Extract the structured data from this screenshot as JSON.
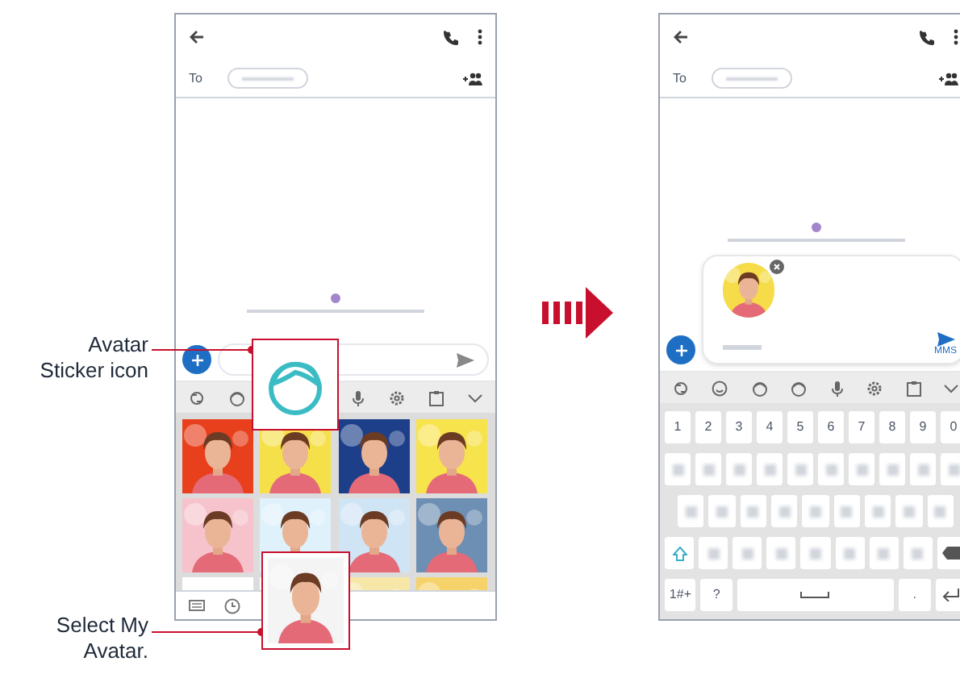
{
  "callouts": [
    {
      "text": "Avatar Sticker icon"
    },
    {
      "text": "Select My Avatar."
    }
  ],
  "left_screen": {
    "to_label": "To"
  },
  "right_screen": {
    "to_label": "To",
    "send_label": "MMS",
    "number_keys": [
      "1",
      "2",
      "3",
      "4",
      "5",
      "6",
      "7",
      "8",
      "9",
      "0"
    ],
    "letter_rows": [
      [
        {
          "kind": "letter"
        },
        {
          "kind": "letter"
        },
        {
          "kind": "letter"
        },
        {
          "kind": "letter"
        },
        {
          "kind": "letter"
        },
        {
          "kind": "letter"
        },
        {
          "kind": "letter"
        },
        {
          "kind": "letter"
        },
        {
          "kind": "letter"
        },
        {
          "kind": "letter"
        }
      ],
      [
        {
          "kind": "letter"
        },
        {
          "kind": "letter"
        },
        {
          "kind": "letter"
        },
        {
          "kind": "letter"
        },
        {
          "kind": "letter"
        },
        {
          "kind": "letter"
        },
        {
          "kind": "letter"
        },
        {
          "kind": "letter"
        },
        {
          "kind": "letter"
        }
      ],
      [
        {
          "kind": "shift"
        },
        {
          "kind": "letter"
        },
        {
          "kind": "letter"
        },
        {
          "kind": "letter"
        },
        {
          "kind": "letter"
        },
        {
          "kind": "letter"
        },
        {
          "kind": "letter"
        },
        {
          "kind": "letter"
        },
        {
          "kind": "backspace"
        }
      ]
    ],
    "bottom_row": [
      {
        "kind": "key",
        "label": "1#+"
      },
      {
        "kind": "key",
        "label": "?"
      },
      {
        "kind": "space"
      },
      {
        "kind": "key",
        "label": "."
      },
      {
        "kind": "enter"
      }
    ]
  }
}
